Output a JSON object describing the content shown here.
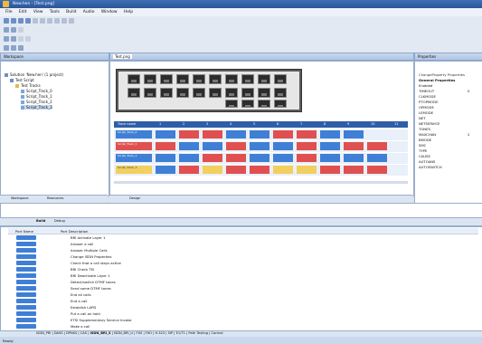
{
  "window": {
    "title": "New.hen - [Test.png]"
  },
  "menu": [
    "File",
    "Edit",
    "View",
    "Tools",
    "Build",
    "Audio",
    "Window",
    "Help"
  ],
  "workspace": {
    "header": "Workspace",
    "tree": [
      "Solution 'New.hen' (1 project)",
      "Test Script",
      "Test Tracks",
      "Script_Track_0",
      "Script_Track_1",
      "Script_Track_2",
      "Script_Track_3"
    ],
    "tabs": [
      "Workspace",
      "Resources"
    ]
  },
  "editor": {
    "tab": "Test.png",
    "design_tab": "Design",
    "track_header": "Track name",
    "columns": [
      "1",
      "2",
      "3",
      "4",
      "5",
      "6",
      "7",
      "8",
      "9",
      "10",
      "11"
    ],
    "tracks": [
      "Script_Track_0",
      "Script_Track_1",
      "Script_Track_2",
      "Script_Track_3"
    ]
  },
  "properties": {
    "header": "Properties",
    "group": "ChangeProperty Properties",
    "section": "General Properties",
    "items": [
      "Enabled",
      "TIMEOUT",
      "CLKMODE",
      "PTOPMODE",
      "OPMODE",
      "LEMODE",
      "NET",
      "NETSERVICE",
      "TONES",
      "MAXCHAN",
      "BMODE",
      "SMC",
      "TYPE",
      "CAUSE",
      "AUTOANS",
      "AUTOSWITCH"
    ],
    "values": {
      "TIMEOUT": "0",
      "MAXCHAN": "2"
    }
  },
  "output": {
    "tabs": [
      "Build",
      "Debug"
    ]
  },
  "ports": {
    "col_name": "Port Name",
    "col_desc": "Port Description",
    "rows": [
      "BRI Activate Layer 1",
      "Answer a call",
      "Answer Multiple Calls",
      "Change ISDN Properties",
      "Check that a call stays active",
      "BRI Check TEI",
      "BRI Deactivate Layer 1",
      "Detect/switch DTMF tones",
      "Send some DTMF tones",
      "End all calls",
      "End a call",
      "Establish LAPD",
      "Put a call on hold",
      "ETSI Supplementary Service Invoke",
      "Make a call"
    ],
    "tabs": [
      "ISDN_PRI",
      "DASS",
      "DPNSS",
      "CAS",
      "ISDN_BRI_S",
      "ISDN_BRI_U",
      "FXS",
      "FXO",
      "H.323",
      "SIP",
      "E1/T1",
      "Path Testing",
      "Control"
    ]
  },
  "status": {
    "text": "Ready"
  },
  "colors": {
    "blue": "#3f7fd6",
    "red": "#e05050",
    "yellow": "#f2d060",
    "gray": "#a0a0a0"
  }
}
